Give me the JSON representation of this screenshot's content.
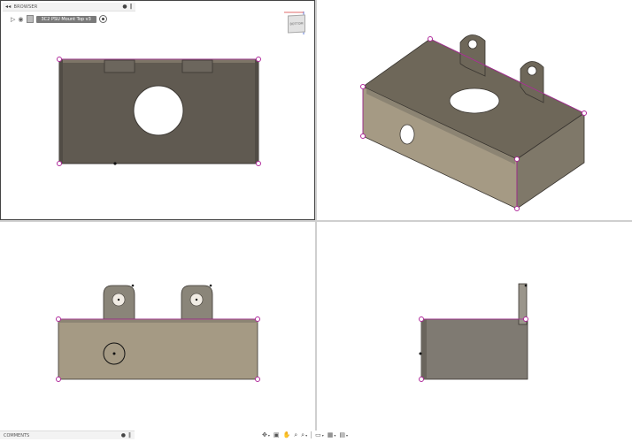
{
  "browser": {
    "header": "BROWSER",
    "document": "3C2 PSU Mount Top v3"
  },
  "viewcube": {
    "label": "BOTTOM"
  },
  "comments": {
    "label": "COMMENTS"
  },
  "toolbar": {
    "icons": [
      "orbit-icon",
      "look-at-icon",
      "pan-icon",
      "zoom-icon",
      "fit-icon",
      "display-settings-icon",
      "grid-icon",
      "viewports-icon"
    ]
  },
  "colors": {
    "body_dark": "#605a51",
    "body_tan": "#a59a84",
    "sketch_magenta": "#b02a9c"
  }
}
